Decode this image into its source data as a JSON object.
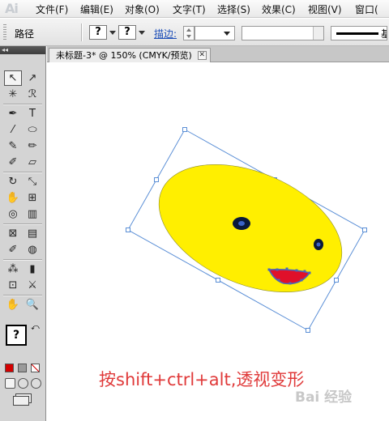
{
  "app": {
    "logo_text": "Ai"
  },
  "menu": {
    "items": [
      {
        "label": "文件(F)"
      },
      {
        "label": "编辑(E)"
      },
      {
        "label": "对象(O)"
      },
      {
        "label": "文字(T)"
      },
      {
        "label": "选择(S)"
      },
      {
        "label": "效果(C)"
      },
      {
        "label": "视图(V)"
      },
      {
        "label": "窗口("
      }
    ]
  },
  "control_bar": {
    "selection_label": "路径",
    "fill_swatch": "?",
    "stroke_swatch": "?",
    "stroke_label": "描边:",
    "stroke_weight_value": "",
    "brush_label": "基"
  },
  "document_tab": {
    "title": "未标题-3* @ 150% (CMYK/预览)",
    "close_glyph": "✕"
  },
  "canvas": {
    "caption": "按shift+ctrl+alt,透视变形",
    "watermark": "Bai 经验",
    "colors": {
      "face_fill": "#ffef00",
      "bounding_box": "#5b8fd6",
      "mouth_fill": "#e0102a",
      "eye_fill": "#0a1a3a",
      "caption": "#e03a3a"
    }
  },
  "toolbox": {
    "tools": [
      {
        "icon": "selection-tool-icon",
        "glyph": "↖"
      },
      {
        "icon": "direct-selection-tool-icon",
        "glyph": "↗"
      },
      {
        "icon": "magic-wand-tool-icon",
        "glyph": "✳"
      },
      {
        "icon": "lasso-tool-icon",
        "glyph": "ℛ"
      },
      {
        "icon": "pen-tool-icon",
        "glyph": "✒"
      },
      {
        "icon": "type-tool-icon",
        "glyph": "T"
      },
      {
        "icon": "line-tool-icon",
        "glyph": "⁄"
      },
      {
        "icon": "ellipse-tool-icon",
        "glyph": "⬭"
      },
      {
        "icon": "paintbrush-tool-icon",
        "glyph": "✎"
      },
      {
        "icon": "pencil-tool-icon",
        "glyph": "✏"
      },
      {
        "icon": "blob-brush-tool-icon",
        "glyph": "✐"
      },
      {
        "icon": "eraser-tool-icon",
        "glyph": "▱"
      },
      {
        "icon": "rotate-tool-icon",
        "glyph": "↻"
      },
      {
        "icon": "scale-tool-icon",
        "glyph": "⤡"
      },
      {
        "icon": "warp-tool-icon",
        "glyph": "✋"
      },
      {
        "icon": "free-transform-tool-icon",
        "glyph": "⊞"
      },
      {
        "icon": "shape-builder-tool-icon",
        "glyph": "◎"
      },
      {
        "icon": "perspective-grid-tool-icon",
        "glyph": "▥"
      },
      {
        "icon": "mesh-tool-icon",
        "glyph": "⊠"
      },
      {
        "icon": "gradient-tool-icon",
        "glyph": "▤"
      },
      {
        "icon": "eyedropper-tool-icon",
        "glyph": "✐"
      },
      {
        "icon": "blend-tool-icon",
        "glyph": "◍"
      },
      {
        "icon": "symbol-sprayer-tool-icon",
        "glyph": "⁂"
      },
      {
        "icon": "column-graph-tool-icon",
        "glyph": "▮"
      },
      {
        "icon": "artboard-tool-icon",
        "glyph": "⊡"
      },
      {
        "icon": "slice-tool-icon",
        "glyph": "⚔"
      },
      {
        "icon": "hand-tool-icon",
        "glyph": "✋"
      },
      {
        "icon": "zoom-tool-icon",
        "glyph": "🔍"
      }
    ],
    "fill_stroke_glyph": "?",
    "color_mode_icons": [
      "color-mode-icon",
      "gradient-mode-icon",
      "none-mode-icon"
    ],
    "draw_mode_icons": [
      "draw-normal-icon",
      "draw-behind-icon",
      "draw-inside-icon"
    ],
    "screen_mode_icon": "screen-mode-icon"
  }
}
